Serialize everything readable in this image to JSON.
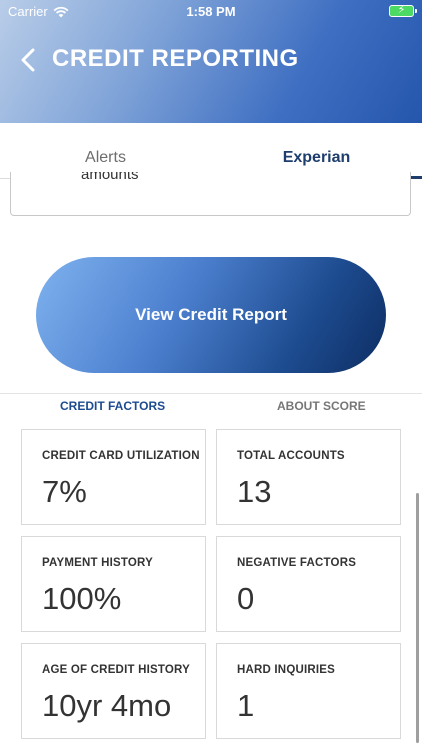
{
  "status_bar": {
    "carrier": "Carrier",
    "time": "1:58 PM"
  },
  "header": {
    "title": "CREDIT REPORTING",
    "back_icon": "chevron-left-icon"
  },
  "tabs": [
    {
      "label": "Alerts",
      "active": false
    },
    {
      "label": "Experian",
      "active": true
    }
  ],
  "scroll_card": {
    "visible_text": "amounts"
  },
  "view_report": {
    "label": "View Credit Report"
  },
  "subtabs": [
    {
      "label": "CREDIT FACTORS",
      "active": true
    },
    {
      "label": "ABOUT SCORE",
      "active": false
    }
  ],
  "factors": [
    {
      "label": "CREDIT CARD UTILIZATION",
      "value": "7%"
    },
    {
      "label": "TOTAL ACCOUNTS",
      "value": "13"
    },
    {
      "label": "PAYMENT HISTORY",
      "value": "100%"
    },
    {
      "label": "NEGATIVE FACTORS",
      "value": "0"
    },
    {
      "label": "AGE OF CREDIT HISTORY",
      "value": "10yr 4mo"
    },
    {
      "label": "HARD INQUIRIES",
      "value": "1"
    }
  ],
  "colors": {
    "accent_dark": "#1d3d6d",
    "battery_green": "#4cd964"
  }
}
